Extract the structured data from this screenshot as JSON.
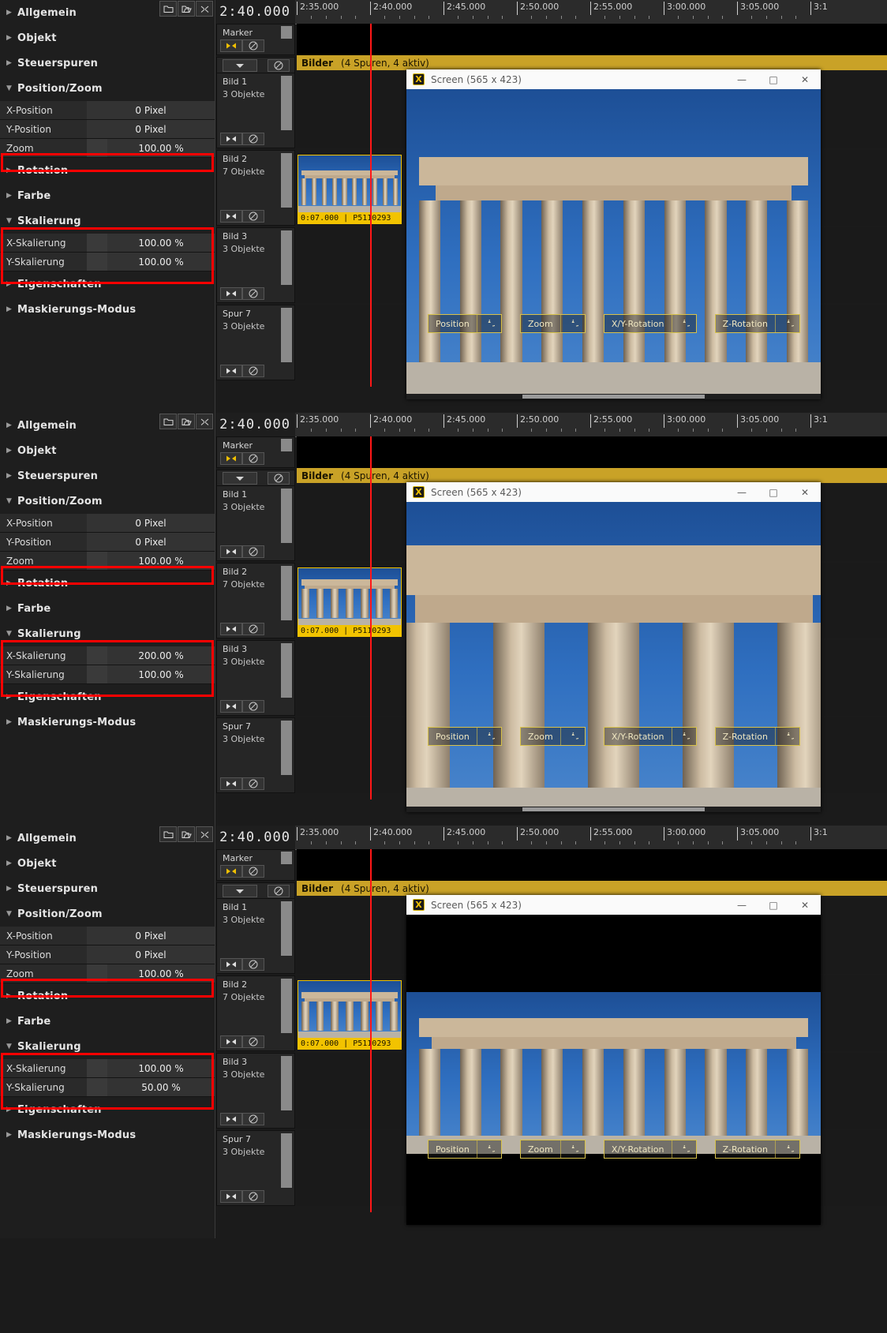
{
  "app": {
    "sections": [
      "Allgemein",
      "Objekt",
      "Steuerspuren",
      "Position/Zoom",
      "Rotation",
      "Farbe",
      "Skalierung",
      "Eigenschaften",
      "Maskierungs-Modus"
    ],
    "field_labels": {
      "x_position": "X-Position",
      "y_position": "Y-Position",
      "zoom": "Zoom",
      "x_scale": "X-Skalierung",
      "y_scale": "Y-Skalierung"
    }
  },
  "panels": [
    {
      "id": "panel-1",
      "position_zoom": {
        "x_position": "0 Pixel",
        "y_position": "0 Pixel",
        "zoom": "100.00 %"
      },
      "skalierung": {
        "x_scale": "100.00 %",
        "y_scale": "100.00 %"
      },
      "preview_variant": "full"
    },
    {
      "id": "panel-2",
      "position_zoom": {
        "x_position": "0 Pixel",
        "y_position": "0 Pixel",
        "zoom": "100.00 %"
      },
      "skalierung": {
        "x_scale": "200.00 %",
        "y_scale": "100.00 %"
      },
      "preview_variant": "wide"
    },
    {
      "id": "panel-3",
      "position_zoom": {
        "x_position": "0 Pixel",
        "y_position": "0 Pixel",
        "zoom": "100.00 %"
      },
      "skalierung": {
        "x_scale": "100.00 %",
        "y_scale": "50.00 %"
      },
      "preview_variant": "short"
    }
  ],
  "timeline": {
    "current_timecode": "2:40.000",
    "ruler_ticks": [
      "2:35.000",
      "2:40.000",
      "2:45.000",
      "2:50.000",
      "2:55.000",
      "3:00.000",
      "3:05.000",
      "3:1"
    ],
    "marker_track": {
      "label": "Marker"
    },
    "group_track": {
      "label": "Bilder",
      "info": "(4 Spuren, 4 aktiv)"
    },
    "tracks": [
      {
        "name": "Bild 1",
        "sub": "3 Objekte"
      },
      {
        "name": "Bild 2",
        "sub": "7 Objekte"
      },
      {
        "name": "Bild 3",
        "sub": "3 Objekte"
      },
      {
        "name": "Spur 7",
        "sub": "3 Objekte"
      }
    ],
    "clip": {
      "caption": "0:07.000 | P5110293"
    }
  },
  "screen_window": {
    "title": "Screen (565 x 423)",
    "icon": "X",
    "minimize": "—",
    "maximize": "□",
    "close": "✕",
    "overlay_buttons": [
      "Position",
      "Zoom",
      "X/Y-Rotation",
      "Z-Rotation"
    ]
  },
  "colors": {
    "highlight": "#ff0000",
    "group_track": "#c9a227",
    "playhead": "#ff1717",
    "clip_border": "#f2c300"
  }
}
